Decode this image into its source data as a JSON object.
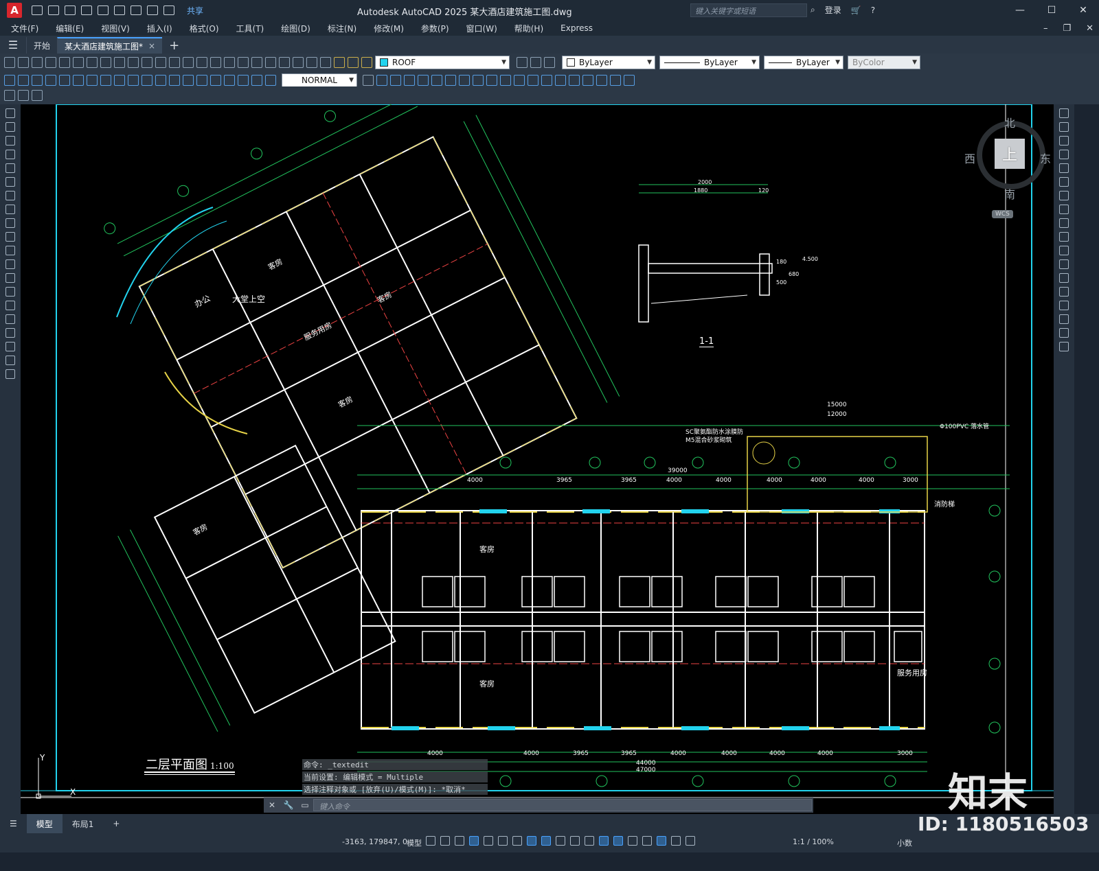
{
  "titlebar": {
    "logo": "A",
    "share": "共享",
    "title": "Autodesk AutoCAD 2025    某大酒店建筑施工图.dwg",
    "search_placeholder": "键入关键字或短语",
    "login": "登录",
    "minimize": "—",
    "maximize": "☐",
    "close": "✕"
  },
  "menu": [
    "文件(F)",
    "编辑(E)",
    "视图(V)",
    "插入(I)",
    "格式(O)",
    "工具(T)",
    "绘图(D)",
    "标注(N)",
    "修改(M)",
    "参数(P)",
    "窗口(W)",
    "帮助(H)",
    "Express"
  ],
  "doc_controls": {
    "minimize": "–",
    "restore": "❐",
    "close": "✕"
  },
  "tabs": {
    "start": "开始",
    "file": "某大酒店建筑施工图*",
    "close": "×",
    "add": "+"
  },
  "layer": {
    "name": "ROOF",
    "color": "#22d3ee"
  },
  "props": {
    "color": "ByLayer",
    "linetype": "ByLayer",
    "lineweight": "ByLayer",
    "plotstyle": "ByColor"
  },
  "dimstyle": "NORMAL",
  "viewcube": {
    "north": "北",
    "south": "南",
    "east": "东",
    "west": "西",
    "face": "上",
    "wcs": "WCS"
  },
  "drawing": {
    "plan_title": "二层平面图",
    "plan_scale": "1:100",
    "section_label": "1-1",
    "rooms": [
      "办公",
      "大堂上空",
      "客房",
      "服务用房",
      "客房",
      "客房",
      "客房",
      "客房",
      "客房",
      "服务用房"
    ],
    "dims_top": [
      "4000",
      "3965",
      "3965",
      "4000",
      "4000",
      "4000",
      "4000",
      "4000",
      "3000"
    ],
    "dim_total_top": "39000",
    "dim_15000": "15000",
    "dim_12000": "12000",
    "dims_bottom": [
      "4000",
      "4000",
      "3965",
      "3965",
      "4000",
      "4000",
      "4000",
      "4000",
      "3000"
    ],
    "dim_total_44000": "44000",
    "dim_total_47000": "47000",
    "note_pipe": "Φ100PVC 落水管",
    "note_waterproof": "SC聚氨酯防水涂膜防",
    "note_mortar": "M5混合砂浆砌筑",
    "note_escape": "消防梯",
    "section_dims": [
      "2000",
      "1880",
      "120",
      "180",
      "500",
      "680",
      "4.500"
    ]
  },
  "command": {
    "history": [
      "命令: _textedit",
      "当前设置: 编辑模式 = Multiple",
      "选择注释对象或 [放弃(U)/模式(M)]: *取消*"
    ],
    "placeholder": "键入命令"
  },
  "layout_tabs": [
    "模型",
    "布局1",
    "+"
  ],
  "status": {
    "coords": "-3163, 179847, 0",
    "model": "模型",
    "zoom": "1:1 / 100%",
    "units": "小数"
  },
  "watermark": {
    "brand": "知末",
    "id": "ID: 1180516503"
  }
}
